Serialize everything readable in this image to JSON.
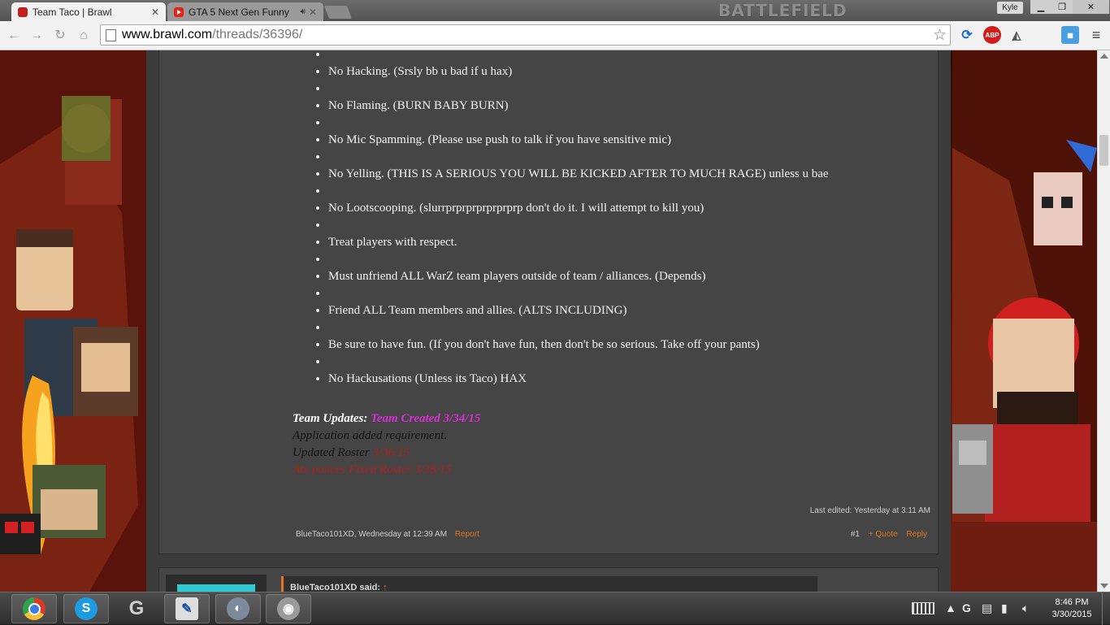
{
  "browser": {
    "tabs": [
      {
        "label": "Team Taco | Brawl",
        "active": true
      },
      {
        "label": "GTA 5 Next Gen Funny",
        "active": false
      }
    ],
    "brand_watermark": "BATTLEFIELD",
    "profile_name": "Kyle",
    "url_host": "www.brawl.com",
    "url_path": "/threads/36396/",
    "extensions": [
      "refresh-icon",
      "adblock-icon",
      "shark-icon",
      "app-icon"
    ],
    "abp_label": "ABP"
  },
  "thread": {
    "rules": [
      "No Hacking. (Srsly bb u bad if u hax)",
      "No Flaming. (BURN BABY BURN)",
      "No Mic Spamming. (Please use push to talk if you have sensitive mic)",
      "No Yelling. (THIS IS A SERIOUS YOU WILL BE KICKED AFTER TO MUCH RAGE) unless u bae",
      "No Lootscooping. (slurrprprprprprprprp don't do it. I will attempt to kill you)",
      "Treat players with respect.",
      "Must unfriend ALL WarZ team players outside of team / alliances. (Depends)",
      "Friend ALL Team members and allies. (ALTS INCLUDING)",
      "Be sure to have fun. (If you don't have fun, then don't be so serious. Take off your pants)",
      "No Hackusations (Unless its Taco) HAX"
    ],
    "updates": {
      "heading": "Team Updates:",
      "created": "Team Created 3/34/15",
      "application": "Application added requirement.",
      "roster_label": "Updated Roster",
      "roster_date": "3/36/15",
      "fixed": "Ate ponces Fixed Roster 3/38/15"
    },
    "last_edited": "Last edited: Yesterday at 3:11 AM",
    "author_line": "BlueTaco101XD, Wednesday at 12:39 AM",
    "report_label": "Report",
    "post_number": "#1",
    "quote_label": "+ Quote",
    "reply_label": "Reply",
    "quote_author": "BlueTaco101XD said:",
    "quote_arrow": "↑"
  },
  "taskbar": {
    "apps": [
      "chrome",
      "skype",
      "logitech",
      "pen-tool",
      "teamspeak",
      "speaker"
    ],
    "time": "8:46 PM",
    "date": "3/30/2015"
  },
  "colors": {
    "accent_orange": "#e47522",
    "update_pink": "#d92fd6",
    "update_red": "#b21e1e",
    "post_bg": "#454545"
  }
}
